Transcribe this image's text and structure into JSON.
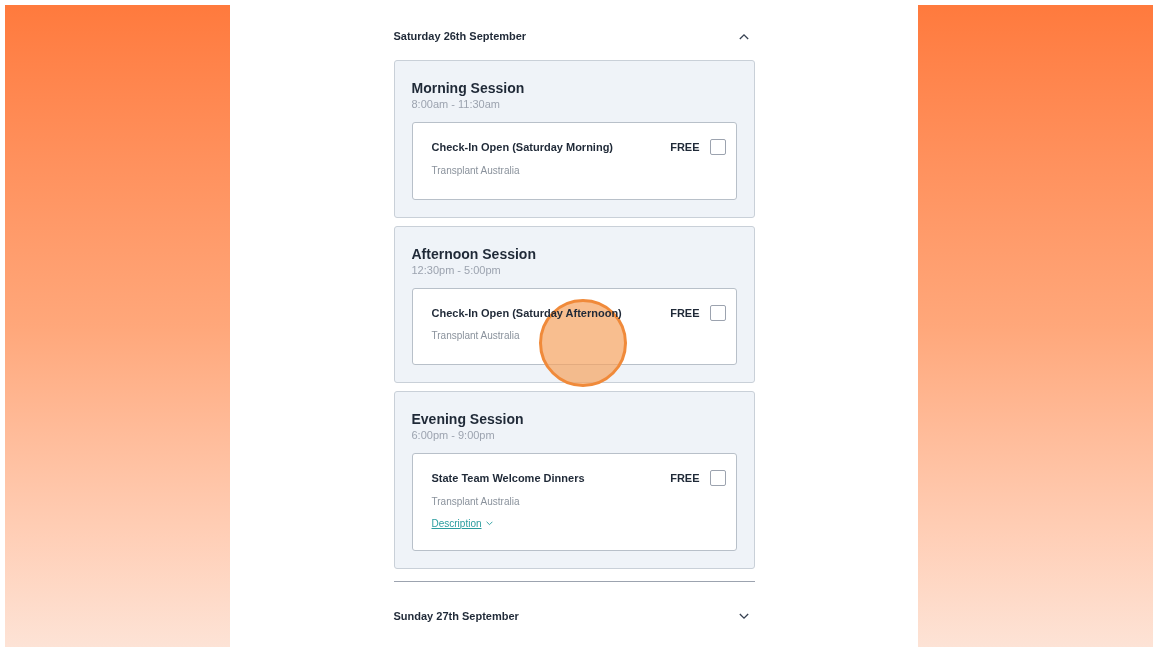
{
  "days": [
    {
      "label": "Saturday 26th September",
      "expanded": true,
      "sessions": [
        {
          "title": "Morning Session",
          "time": "8:00am - 11:30am",
          "items": [
            {
              "title": "Check-In Open (Saturday Morning)",
              "organiser": "Transplant Australia",
              "price": "FREE",
              "checked": false
            }
          ]
        },
        {
          "title": "Afternoon Session",
          "time": "12:30pm - 5:00pm",
          "items": [
            {
              "title": "Check-In Open (Saturday Afternoon)",
              "organiser": "Transplant Australia",
              "price": "FREE",
              "checked": false
            }
          ]
        },
        {
          "title": "Evening Session",
          "time": "6:00pm - 9:00pm",
          "items": [
            {
              "title": "State Team Welcome Dinners",
              "organiser": "Transplant Australia",
              "price": "FREE",
              "checked": false,
              "description": {
                "label": "Description",
                "expanded": false
              }
            }
          ]
        }
      ]
    },
    {
      "label": "Sunday 27th September",
      "expanded": false
    }
  ]
}
